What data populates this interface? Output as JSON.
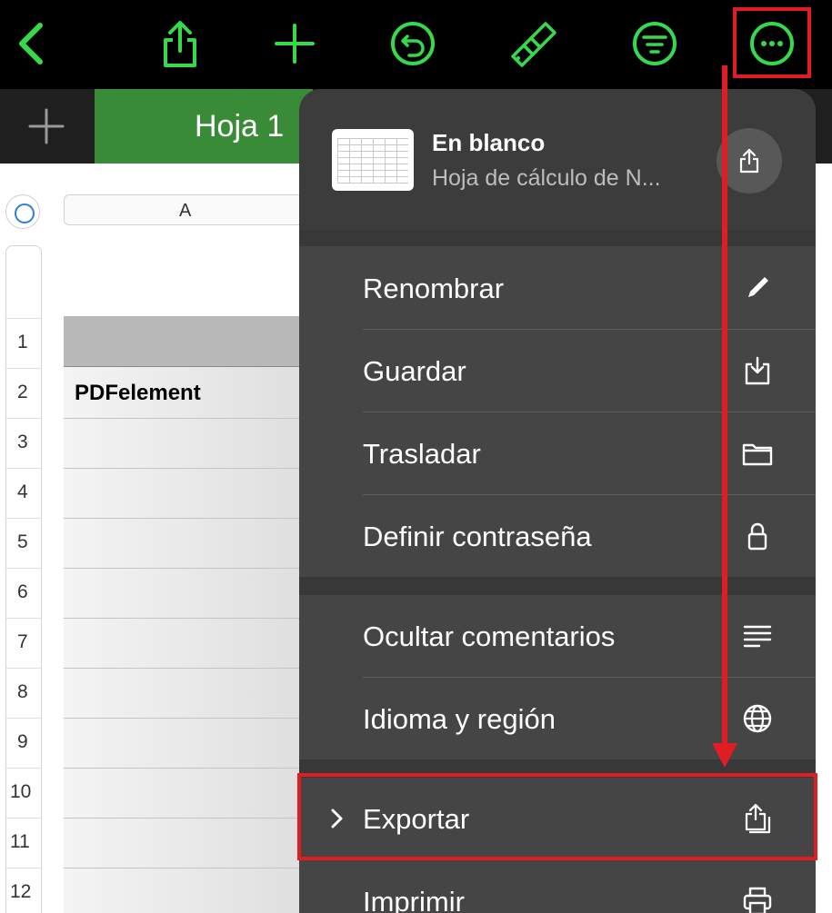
{
  "toolbar": {
    "icons": [
      "back-icon",
      "share-icon",
      "add-icon",
      "undo-icon",
      "format-brush-icon",
      "organize-icon",
      "more-icon"
    ],
    "accent": "#35d94a"
  },
  "sheet_tabs": {
    "active_tab": "Hoja 1",
    "active_color": "#3a8b37"
  },
  "spreadsheet": {
    "column_header": "A",
    "row_numbers": [
      "1",
      "2",
      "3",
      "4",
      "5",
      "6",
      "7",
      "8",
      "9",
      "10",
      "11",
      "12"
    ],
    "cell_a2": "PDFelement"
  },
  "menu": {
    "document": {
      "title": "En blanco",
      "subtitle": "Hoja de cálculo de N..."
    },
    "items": [
      {
        "label": "Renombrar",
        "icon": "pencil-icon"
      },
      {
        "label": "Guardar",
        "icon": "download-tray-icon"
      },
      {
        "label": "Trasladar",
        "icon": "folder-icon"
      },
      {
        "label": "Definir contraseña",
        "icon": "lock-icon"
      },
      {
        "label": "Ocultar comentarios",
        "icon": "lines-icon"
      },
      {
        "label": "Idioma y región",
        "icon": "globe-icon"
      },
      {
        "label": "Exportar",
        "icon": "export-icon"
      },
      {
        "label": "Imprimir",
        "icon": "printer-icon"
      }
    ]
  },
  "annotation_color": "#e11d24"
}
